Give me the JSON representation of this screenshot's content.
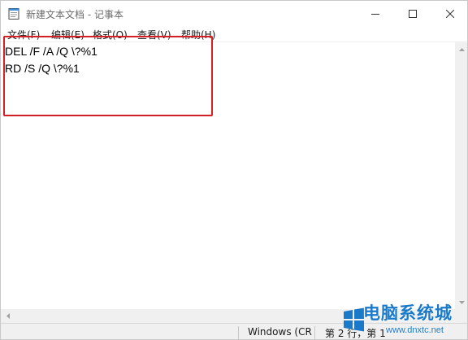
{
  "window": {
    "title": "新建文本文档 - 记事本"
  },
  "menu": {
    "items": [
      "文件(F)",
      "编辑(E)",
      "格式(O)",
      "查看(V)",
      "帮助(H)"
    ]
  },
  "editor": {
    "lines": [
      "DEL /F /A /Q \\?%1",
      "RD /S /Q \\?%1"
    ]
  },
  "status": {
    "encoding_fragment": "Windows (CR",
    "position_fragment": "第 2 行，第 1"
  },
  "watermark": {
    "brand": "电脑系统城",
    "url": "www.dnxtc.net"
  },
  "colors": {
    "highlight": "#d32025",
    "watermark": "#1a79c9"
  }
}
